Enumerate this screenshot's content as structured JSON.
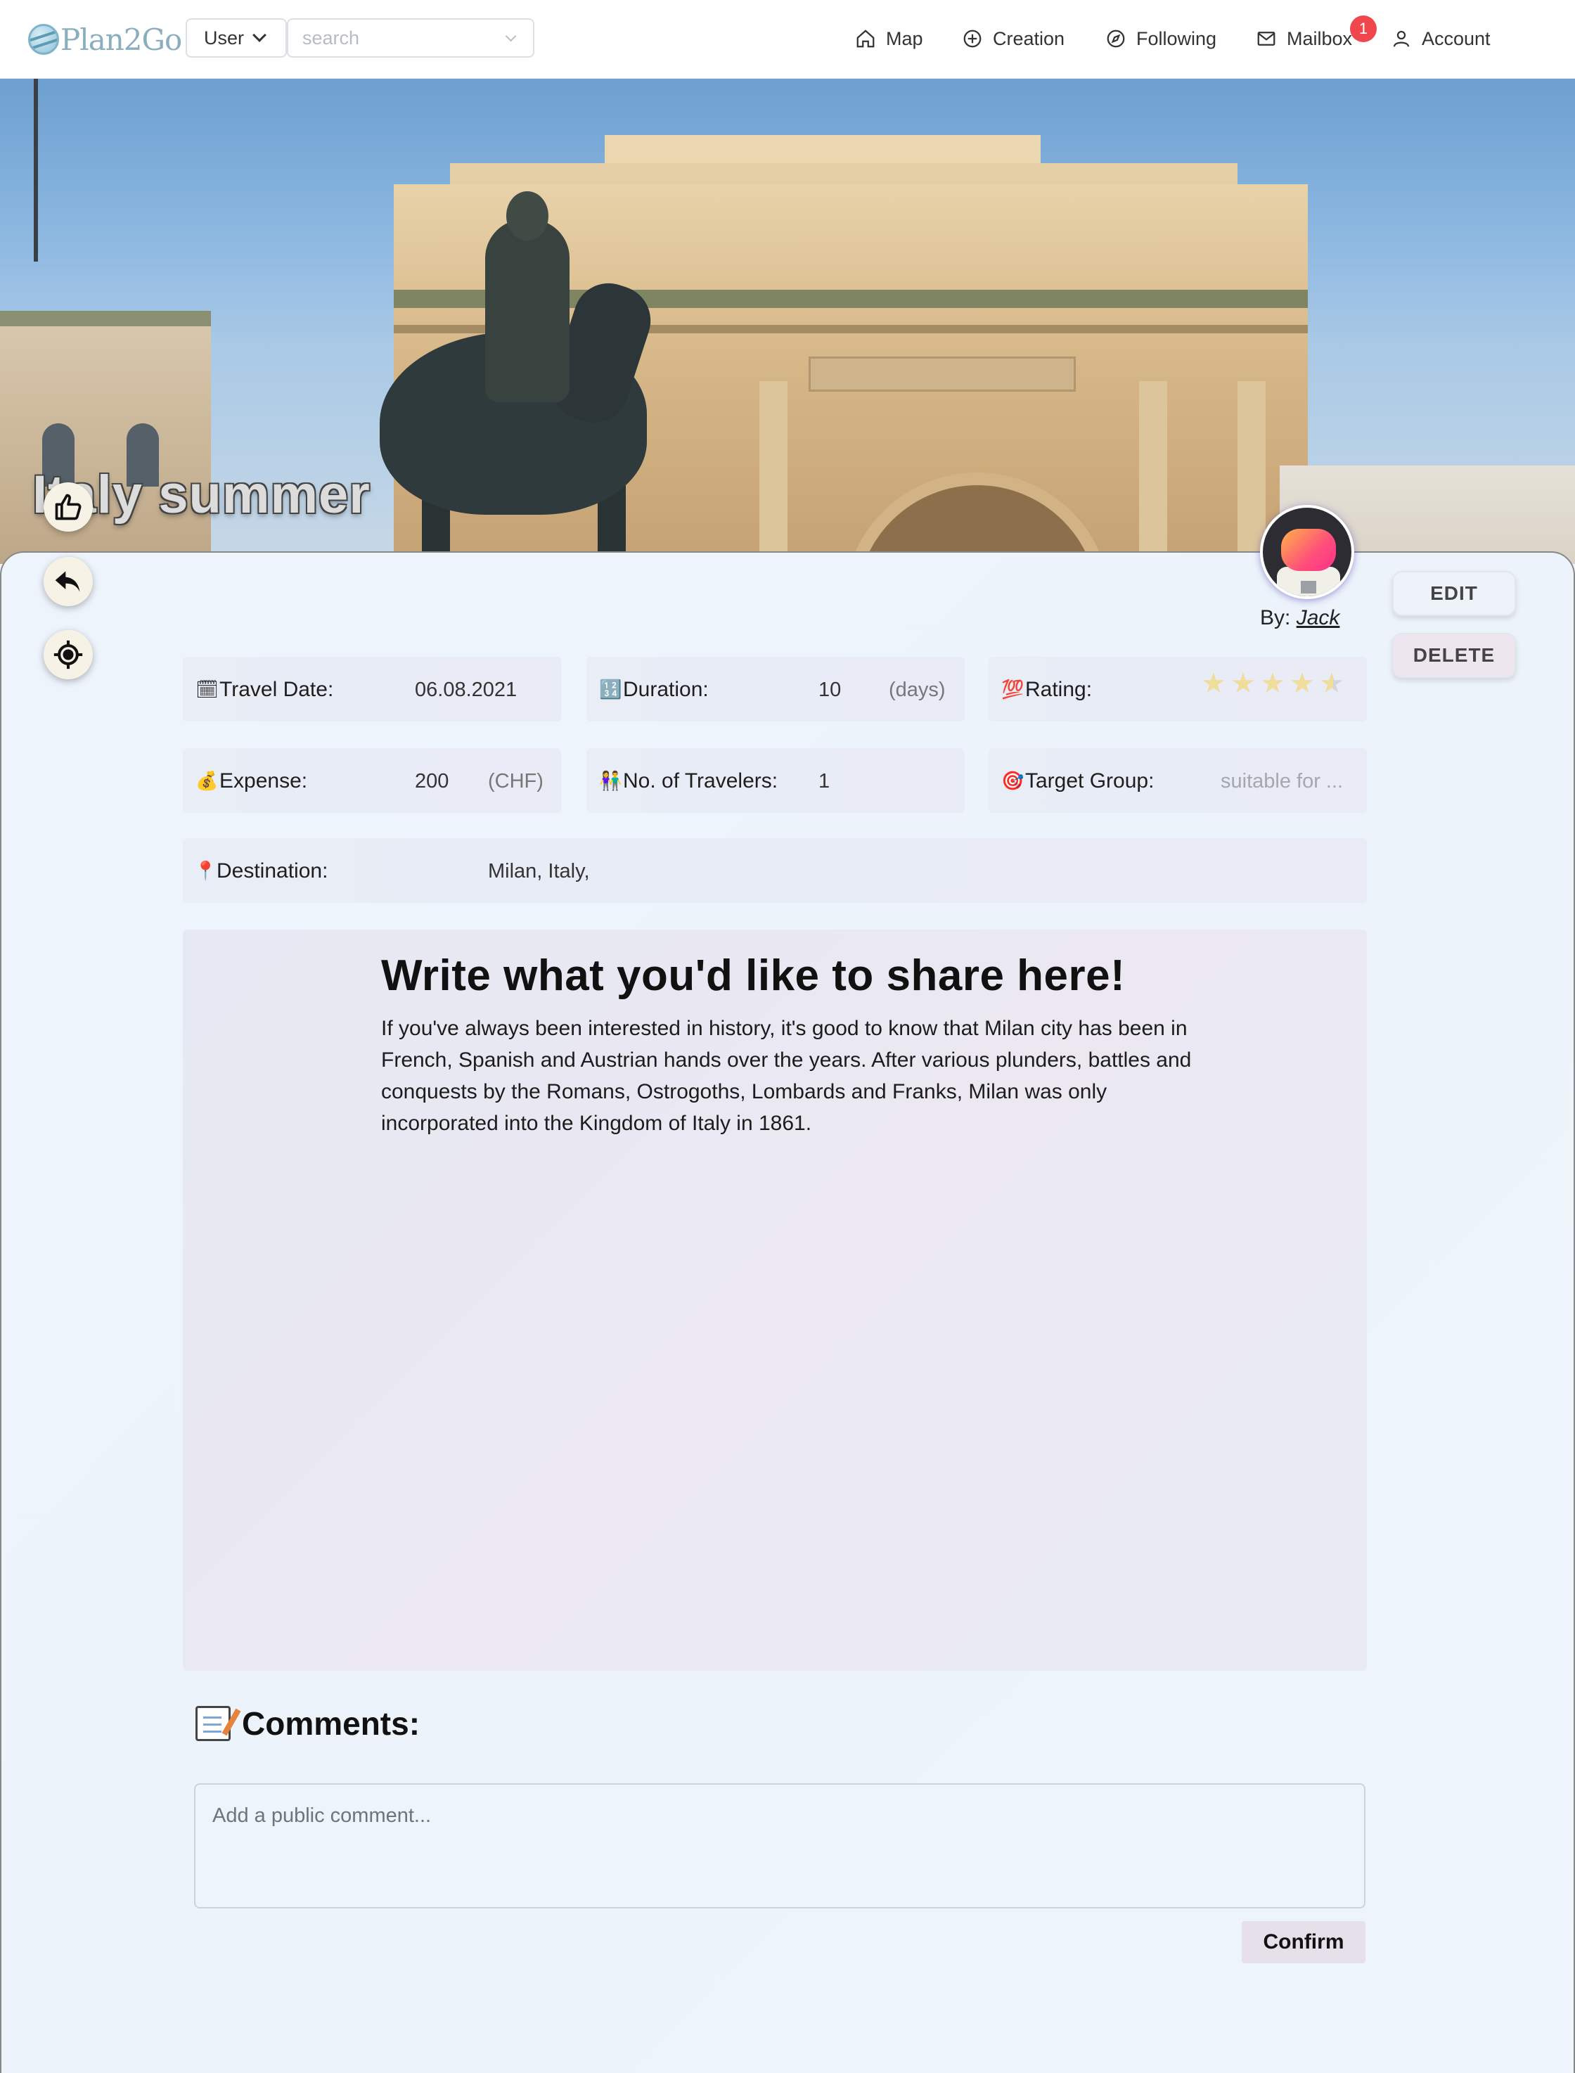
{
  "navbar": {
    "logo_text": "Plan2Go",
    "user_select": "User",
    "search_placeholder": "search",
    "items": [
      {
        "label": "Map",
        "icon": "home-icon"
      },
      {
        "label": "Creation",
        "icon": "plus-circle-icon"
      },
      {
        "label": "Following",
        "icon": "compass-icon"
      },
      {
        "label": "Mailbox",
        "icon": "mail-icon"
      },
      {
        "label": "Account",
        "icon": "user-icon"
      }
    ],
    "mailbox_badge": "1"
  },
  "hero": {
    "title": "Italy summer",
    "image": "galleria-vittorio-emanuele-statue-photo"
  },
  "actions": {
    "like_icon": "thumbs-up-icon",
    "back_icon": "reply-arrow-icon",
    "locate_icon": "crosshair-icon"
  },
  "author": {
    "by_prefix": "By:",
    "name": "Jack",
    "avatar": "astronaut-avatar"
  },
  "buttons": {
    "edit": "EDIT",
    "delete": "DELETE",
    "confirm": "Confirm"
  },
  "info": {
    "travel_date": {
      "icon": "🗓",
      "label": "Travel Date:",
      "value": "06.08.2021"
    },
    "duration": {
      "icon": "🔢",
      "label": "Duration:",
      "value": "10",
      "unit": "(days)"
    },
    "rating": {
      "icon": "💯",
      "label": "Rating:",
      "value": 4.5,
      "max": 5
    },
    "expense": {
      "icon": "💰",
      "label": "Expense:",
      "value": "200",
      "unit": "(CHF)"
    },
    "travelers": {
      "icon": "👫",
      "label": "No. of Travelers:",
      "value": "1"
    },
    "target_group": {
      "icon": "🎯",
      "label": "Target Group:",
      "placeholder": "suitable for ..."
    },
    "destination": {
      "icon": "📍",
      "label": "Destination:",
      "value": "Milan, Italy,"
    }
  },
  "story": {
    "heading": "Write what you'd like to share here!",
    "body": "If you've always been interested in history, it's good to know that Milan city has been in French, Spanish and Austrian hands over the years. After various plunders, battles and conquests by the Romans, Ostrogoths, Lombards and Franks, Milan was only incorporated into the Kingdom of Italy in 1861."
  },
  "comments": {
    "title": "Comments:",
    "icon": "memo-icon",
    "placeholder": "Add a public comment..."
  },
  "colors": {
    "badge": "#f0474f",
    "star": "#f0dc9b",
    "card_bg": "#eef4fc",
    "delete_bg": "#eee6ef"
  }
}
